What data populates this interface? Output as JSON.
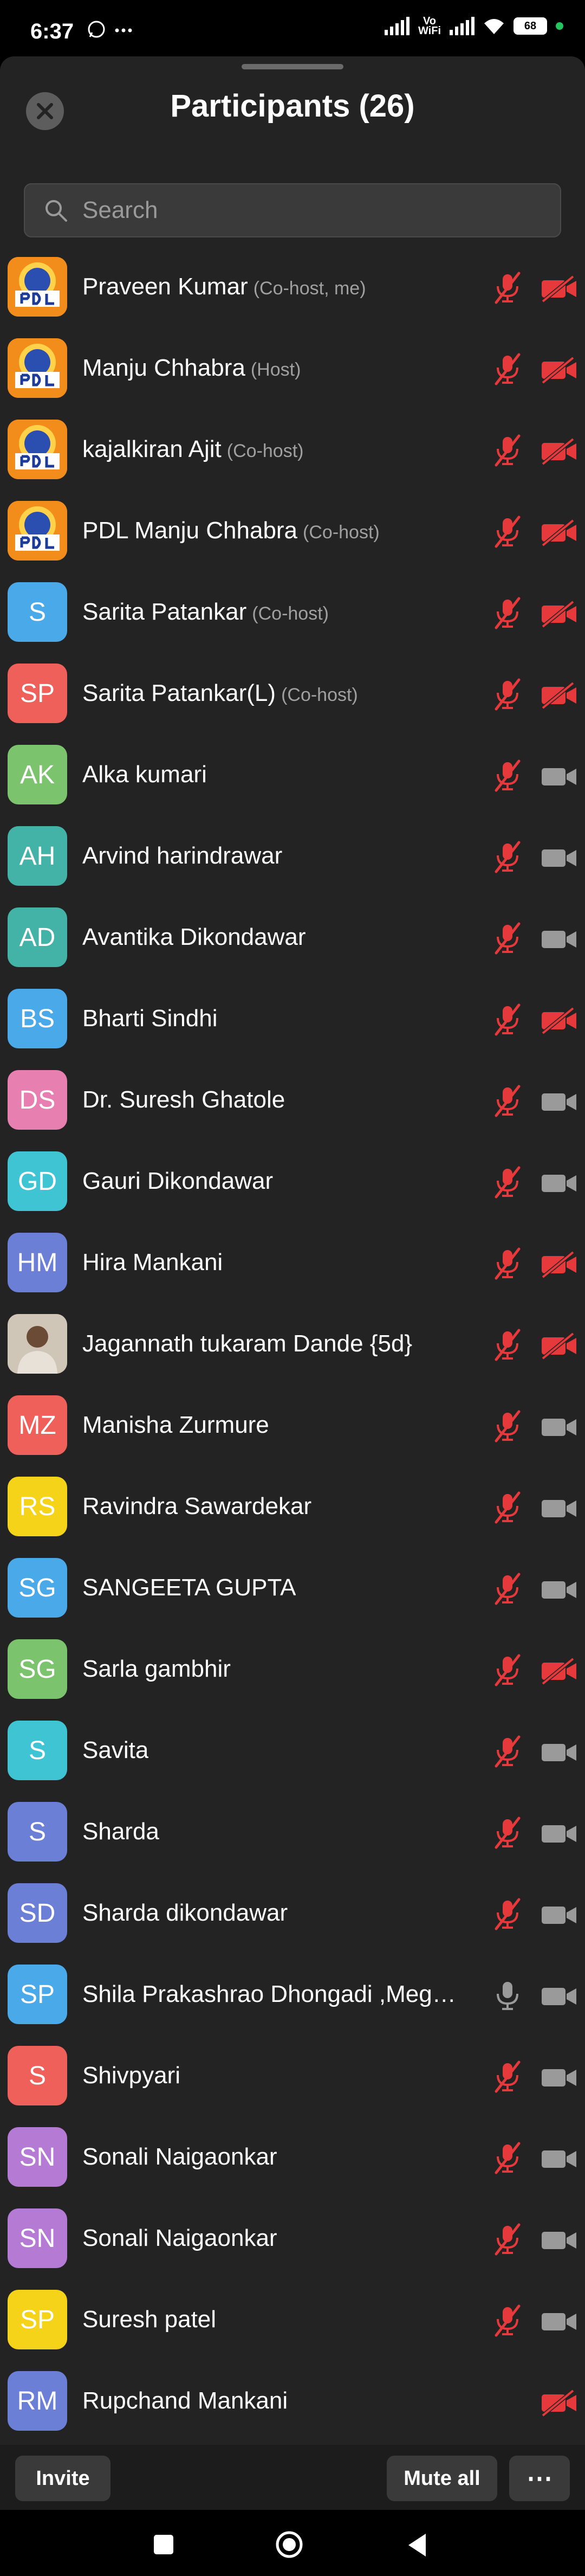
{
  "status": {
    "time": "6:37",
    "left_icons": "⓿ ⋯",
    "vowifi": "Vo\nWiFi",
    "battery": "68"
  },
  "header": {
    "title": "Participants (26)"
  },
  "search": {
    "placeholder": "Search"
  },
  "participants": [
    {
      "name": "Praveen Kumar",
      "role": "(Co-host, me)",
      "avatar": "",
      "avatar_type": "logo",
      "avatar_color": "#f28c1b",
      "mic_muted": true,
      "video_off": true
    },
    {
      "name": "Manju Chhabra",
      "role": "(Host)",
      "avatar": "",
      "avatar_type": "logo",
      "avatar_color": "#f28c1b",
      "mic_muted": true,
      "video_off": true
    },
    {
      "name": "kajalkiran Ajit",
      "role": "(Co-host)",
      "avatar": "",
      "avatar_type": "logo",
      "avatar_color": "#f28c1b",
      "mic_muted": true,
      "video_off": true
    },
    {
      "name": "PDL Manju Chhabra",
      "role": "(Co-host)",
      "avatar": "",
      "avatar_type": "logo",
      "avatar_color": "#f28c1b",
      "mic_muted": true,
      "video_off": true
    },
    {
      "name": "Sarita  Patankar",
      "role": "(Co-host)",
      "avatar": "S",
      "avatar_type": "initials",
      "avatar_color": "#4aa9e8",
      "mic_muted": true,
      "video_off": true
    },
    {
      "name": "Sarita Patankar(L)",
      "role": "(Co-host)",
      "avatar": "SP",
      "avatar_type": "initials",
      "avatar_color": "#f0605a",
      "mic_muted": true,
      "video_off": true
    },
    {
      "name": "Alka kumari",
      "role": "",
      "avatar": "AK",
      "avatar_type": "initials",
      "avatar_color": "#7cc36d",
      "mic_muted": true,
      "video_off": false
    },
    {
      "name": "Arvind harindrawar",
      "role": "",
      "avatar": "AH",
      "avatar_type": "initials",
      "avatar_color": "#42b3a6",
      "mic_muted": true,
      "video_off": false
    },
    {
      "name": "Avantika Dikondawar",
      "role": "",
      "avatar": "AD",
      "avatar_type": "initials",
      "avatar_color": "#42b3a6",
      "mic_muted": true,
      "video_off": false
    },
    {
      "name": "Bharti Sindhi",
      "role": "",
      "avatar": "BS",
      "avatar_type": "initials",
      "avatar_color": "#4aa9e8",
      "mic_muted": true,
      "video_off": true
    },
    {
      "name": "Dr. Suresh  Ghatole",
      "role": "",
      "avatar": "DS",
      "avatar_type": "initials",
      "avatar_color": "#e77fb0",
      "mic_muted": true,
      "video_off": false
    },
    {
      "name": "Gauri Dikondawar",
      "role": "",
      "avatar": "GD",
      "avatar_type": "initials",
      "avatar_color": "#3fc4d4",
      "mic_muted": true,
      "video_off": false
    },
    {
      "name": "Hira Mankani",
      "role": "",
      "avatar": "HM",
      "avatar_type": "initials",
      "avatar_color": "#6c7fd6",
      "mic_muted": true,
      "video_off": true
    },
    {
      "name": "Jagannath tukaram Dande {5d}",
      "role": "",
      "avatar": "",
      "avatar_type": "photo",
      "avatar_color": "#8a7a66",
      "mic_muted": true,
      "video_off": true
    },
    {
      "name": "Manisha Zurmure",
      "role": "",
      "avatar": "MZ",
      "avatar_type": "initials",
      "avatar_color": "#f0605a",
      "mic_muted": true,
      "video_off": false
    },
    {
      "name": "Ravindra Sawardekar",
      "role": "",
      "avatar": "RS",
      "avatar_type": "initials",
      "avatar_color": "#f5d318",
      "mic_muted": true,
      "video_off": false
    },
    {
      "name": "SANGEETA GUPTA",
      "role": "",
      "avatar": "SG",
      "avatar_type": "initials",
      "avatar_color": "#4aa9e8",
      "mic_muted": true,
      "video_off": false
    },
    {
      "name": "Sarla gambhir",
      "role": "",
      "avatar": "SG",
      "avatar_type": "initials",
      "avatar_color": "#7cc36d",
      "mic_muted": true,
      "video_off": true
    },
    {
      "name": "Savita",
      "role": "",
      "avatar": "S",
      "avatar_type": "initials",
      "avatar_color": "#3fc4d4",
      "mic_muted": true,
      "video_off": false
    },
    {
      "name": "Sharda",
      "role": "",
      "avatar": "S",
      "avatar_type": "initials",
      "avatar_color": "#6c7fd6",
      "mic_muted": true,
      "video_off": false
    },
    {
      "name": "Sharda dikondawar",
      "role": "",
      "avatar": "SD",
      "avatar_type": "initials",
      "avatar_color": "#6c7fd6",
      "mic_muted": true,
      "video_off": false
    },
    {
      "name": "Shila Prakashrao Dhongadi ,Meg…",
      "role": "",
      "avatar": "SP",
      "avatar_type": "initials",
      "avatar_color": "#4aa9e8",
      "mic_muted": false,
      "video_off": false
    },
    {
      "name": "Shivpyari",
      "role": "",
      "avatar": "S",
      "avatar_type": "initials",
      "avatar_color": "#f0605a",
      "mic_muted": true,
      "video_off": false
    },
    {
      "name": "Sonali Naigaonkar",
      "role": "",
      "avatar": "SN",
      "avatar_type": "initials",
      "avatar_color": "#b57bd4",
      "mic_muted": true,
      "video_off": false
    },
    {
      "name": "Sonali Naigaonkar",
      "role": "",
      "avatar": "SN",
      "avatar_type": "initials",
      "avatar_color": "#b57bd4",
      "mic_muted": true,
      "video_off": false
    },
    {
      "name": "Suresh patel",
      "role": "",
      "avatar": "SP",
      "avatar_type": "initials",
      "avatar_color": "#f5d318",
      "mic_muted": true,
      "video_off": false
    },
    {
      "name": "Rupchand Mankani",
      "role": "",
      "avatar": "RM",
      "avatar_type": "initials",
      "avatar_color": "#6c7fd6",
      "mic_muted": null,
      "video_off": true
    }
  ],
  "footer": {
    "invite_label": "Invite",
    "mute_all_label": "Mute all",
    "more_label": "⋯"
  },
  "colors": {
    "muted_red": "#e5393b",
    "icon_gray": "#9a9a9a",
    "sheet_bg": "#232323"
  }
}
